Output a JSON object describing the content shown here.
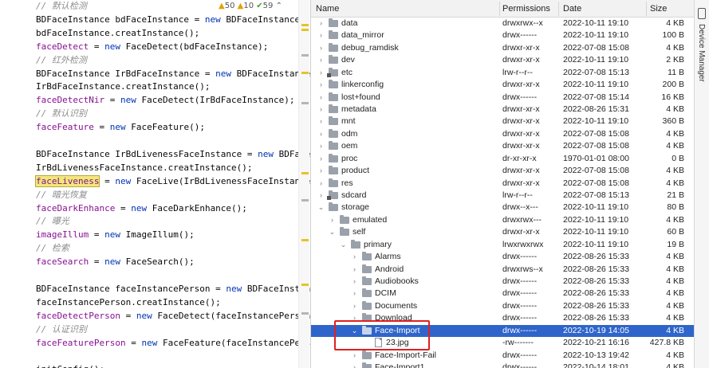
{
  "editor": {
    "inspections": {
      "warnings": "50",
      "weak_warnings": "10",
      "checks": "59"
    },
    "lines": [
      {
        "type": "comment",
        "text": "// 默认检测"
      },
      {
        "type": "code",
        "parts": [
          {
            "t": "BDFaceInstance bdFaceInstance = "
          },
          {
            "t": "new",
            "c": "kw"
          },
          {
            "t": " BDFaceInstance();"
          }
        ]
      },
      {
        "type": "code",
        "parts": [
          {
            "t": "bdFaceInstance.creatInstance();"
          }
        ]
      },
      {
        "type": "code",
        "parts": [
          {
            "t": "faceDetect",
            "c": "fld"
          },
          {
            "t": " = "
          },
          {
            "t": "new",
            "c": "kw"
          },
          {
            "t": " FaceDetect(bdFaceInstance);"
          }
        ]
      },
      {
        "type": "comment",
        "text": "// 红外检测"
      },
      {
        "type": "code",
        "parts": [
          {
            "t": "BDFaceInstance IrBdFaceInstance = "
          },
          {
            "t": "new",
            "c": "kw"
          },
          {
            "t": " BDFaceInstance();"
          }
        ]
      },
      {
        "type": "code",
        "parts": [
          {
            "t": "IrBdFaceInstance.creatInstance();"
          }
        ]
      },
      {
        "type": "code",
        "parts": [
          {
            "t": "faceDetectNir",
            "c": "fld"
          },
          {
            "t": " = "
          },
          {
            "t": "new",
            "c": "kw"
          },
          {
            "t": " FaceDetect(IrBdFaceInstance);"
          }
        ]
      },
      {
        "type": "comment",
        "text": "// 默认识别"
      },
      {
        "type": "code",
        "parts": [
          {
            "t": "faceFeature",
            "c": "fld"
          },
          {
            "t": " = "
          },
          {
            "t": "new",
            "c": "kw"
          },
          {
            "t": " FaceFeature();"
          }
        ]
      },
      {
        "type": "blank"
      },
      {
        "type": "code",
        "parts": [
          {
            "t": "BDFaceInstance IrBdLivenessFaceInstance = "
          },
          {
            "t": "new",
            "c": "kw"
          },
          {
            "t": " BDFaceInstance();"
          }
        ]
      },
      {
        "type": "code",
        "parts": [
          {
            "t": "IrBdLivenessFaceInstance.creatInstance();"
          }
        ]
      },
      {
        "type": "code",
        "parts": [
          {
            "t": "faceLiveness",
            "c": "fld hl"
          },
          {
            "t": " = "
          },
          {
            "t": "new",
            "c": "kw"
          },
          {
            "t": " FaceLive(IrBdLivenessFaceInstance);"
          }
        ]
      },
      {
        "type": "comment",
        "text": "// 暗光恢复"
      },
      {
        "type": "code",
        "parts": [
          {
            "t": "faceDarkEnhance",
            "c": "fld"
          },
          {
            "t": " = "
          },
          {
            "t": "new",
            "c": "kw"
          },
          {
            "t": " FaceDarkEnhance();"
          }
        ]
      },
      {
        "type": "comment",
        "text": "// 曝光"
      },
      {
        "type": "code",
        "parts": [
          {
            "t": "imageIllum",
            "c": "fld"
          },
          {
            "t": " = "
          },
          {
            "t": "new",
            "c": "kw"
          },
          {
            "t": " ImageIllum();"
          }
        ]
      },
      {
        "type": "comment",
        "text": "// 检索"
      },
      {
        "type": "code",
        "parts": [
          {
            "t": "faceSearch",
            "c": "fld"
          },
          {
            "t": " = "
          },
          {
            "t": "new",
            "c": "kw"
          },
          {
            "t": " FaceSearch();"
          }
        ]
      },
      {
        "type": "blank"
      },
      {
        "type": "code",
        "parts": [
          {
            "t": "BDFaceInstance faceInstancePerson = "
          },
          {
            "t": "new",
            "c": "kw"
          },
          {
            "t": " BDFaceInstance();"
          }
        ]
      },
      {
        "type": "code",
        "parts": [
          {
            "t": "faceInstancePerson.creatInstance();"
          }
        ]
      },
      {
        "type": "code",
        "parts": [
          {
            "t": "faceDetectPerson",
            "c": "fld"
          },
          {
            "t": " = "
          },
          {
            "t": "new",
            "c": "kw"
          },
          {
            "t": " FaceDetect(faceInstancePerson);"
          }
        ]
      },
      {
        "type": "comment",
        "text": "// 认证识别"
      },
      {
        "type": "code",
        "parts": [
          {
            "t": "faceFeaturePerson",
            "c": "fld"
          },
          {
            "t": " = "
          },
          {
            "t": "new",
            "c": "kw"
          },
          {
            "t": " FaceFeature(faceInstancePerson);"
          }
        ]
      },
      {
        "type": "blank"
      },
      {
        "type": "code",
        "parts": [
          {
            "t": "initConfig();"
          }
        ]
      }
    ]
  },
  "explorer": {
    "columns": {
      "name": "Name",
      "permissions": "Permissions",
      "date": "Date",
      "size": "Size"
    },
    "rows": [
      {
        "name": "data",
        "perm": "drwxrwx--x",
        "date": "2022-10-11 19:10",
        "size": "4 KB",
        "level": 0,
        "kind": "folder",
        "state": "collapsed"
      },
      {
        "name": "data_mirror",
        "perm": "drwx------",
        "date": "2022-10-11 19:10",
        "size": "100 B",
        "level": 0,
        "kind": "folder",
        "state": "collapsed"
      },
      {
        "name": "debug_ramdisk",
        "perm": "drwxr-xr-x",
        "date": "2022-07-08 15:08",
        "size": "4 KB",
        "level": 0,
        "kind": "folder",
        "state": "collapsed"
      },
      {
        "name": "dev",
        "perm": "drwxr-xr-x",
        "date": "2022-10-11 19:10",
        "size": "2 KB",
        "level": 0,
        "kind": "folder",
        "state": "collapsed"
      },
      {
        "name": "etc",
        "perm": "lrw-r--r--",
        "date": "2022-07-08 15:13",
        "size": "11 B",
        "level": 0,
        "kind": "link",
        "state": "collapsed"
      },
      {
        "name": "linkerconfig",
        "perm": "drwxr-xr-x",
        "date": "2022-10-11 19:10",
        "size": "200 B",
        "level": 0,
        "kind": "folder",
        "state": "collapsed"
      },
      {
        "name": "lost+found",
        "perm": "drwx------",
        "date": "2022-07-08 15:14",
        "size": "16 KB",
        "level": 0,
        "kind": "folder",
        "state": "collapsed"
      },
      {
        "name": "metadata",
        "perm": "drwxr-xr-x",
        "date": "2022-08-26 15:31",
        "size": "4 KB",
        "level": 0,
        "kind": "folder",
        "state": "collapsed"
      },
      {
        "name": "mnt",
        "perm": "drwxr-xr-x",
        "date": "2022-10-11 19:10",
        "size": "360 B",
        "level": 0,
        "kind": "folder",
        "state": "collapsed"
      },
      {
        "name": "odm",
        "perm": "drwxr-xr-x",
        "date": "2022-07-08 15:08",
        "size": "4 KB",
        "level": 0,
        "kind": "folder",
        "state": "collapsed"
      },
      {
        "name": "oem",
        "perm": "drwxr-xr-x",
        "date": "2022-07-08 15:08",
        "size": "4 KB",
        "level": 0,
        "kind": "folder",
        "state": "collapsed"
      },
      {
        "name": "proc",
        "perm": "dr-xr-xr-x",
        "date": "1970-01-01 08:00",
        "size": "0 B",
        "level": 0,
        "kind": "folder",
        "state": "collapsed"
      },
      {
        "name": "product",
        "perm": "drwxr-xr-x",
        "date": "2022-07-08 15:08",
        "size": "4 KB",
        "level": 0,
        "kind": "folder",
        "state": "collapsed"
      },
      {
        "name": "res",
        "perm": "drwxr-xr-x",
        "date": "2022-07-08 15:08",
        "size": "4 KB",
        "level": 0,
        "kind": "folder",
        "state": "collapsed"
      },
      {
        "name": "sdcard",
        "perm": "lrw-r--r--",
        "date": "2022-07-08 15:13",
        "size": "21 B",
        "level": 0,
        "kind": "link",
        "state": "collapsed"
      },
      {
        "name": "storage",
        "perm": "drwx--x---",
        "date": "2022-10-11 19:10",
        "size": "80 B",
        "level": 0,
        "kind": "folder",
        "state": "expanded"
      },
      {
        "name": "emulated",
        "perm": "drwxrwx---",
        "date": "2022-10-11 19:10",
        "size": "4 KB",
        "level": 1,
        "kind": "folder",
        "state": "collapsed"
      },
      {
        "name": "self",
        "perm": "drwxr-xr-x",
        "date": "2022-10-11 19:10",
        "size": "60 B",
        "level": 1,
        "kind": "folder",
        "state": "expanded"
      },
      {
        "name": "primary",
        "perm": "lrwxrwxrwx",
        "date": "2022-10-11 19:10",
        "size": "19 B",
        "level": 2,
        "kind": "folder",
        "state": "expanded"
      },
      {
        "name": "Alarms",
        "perm": "drwx------",
        "date": "2022-08-26 15:33",
        "size": "4 KB",
        "level": 3,
        "kind": "folder",
        "state": "collapsed"
      },
      {
        "name": "Android",
        "perm": "drwxrws--x",
        "date": "2022-08-26 15:33",
        "size": "4 KB",
        "level": 3,
        "kind": "folder",
        "state": "collapsed"
      },
      {
        "name": "Audiobooks",
        "perm": "drwx------",
        "date": "2022-08-26 15:33",
        "size": "4 KB",
        "level": 3,
        "kind": "folder",
        "state": "collapsed"
      },
      {
        "name": "DCIM",
        "perm": "drwx------",
        "date": "2022-08-26 15:33",
        "size": "4 KB",
        "level": 3,
        "kind": "folder",
        "state": "collapsed"
      },
      {
        "name": "Documents",
        "perm": "drwx------",
        "date": "2022-08-26 15:33",
        "size": "4 KB",
        "level": 3,
        "kind": "folder",
        "state": "collapsed"
      },
      {
        "name": "Download",
        "perm": "drwx------",
        "date": "2022-08-26 15:33",
        "size": "4 KB",
        "level": 3,
        "kind": "folder",
        "state": "collapsed"
      },
      {
        "name": "Face-Import",
        "perm": "drwx------",
        "date": "2022-10-19 14:05",
        "size": "4 KB",
        "level": 3,
        "kind": "folder",
        "state": "expanded",
        "selected": true
      },
      {
        "name": "23.jpg",
        "perm": "-rw-------",
        "date": "2022-10-21 16:16",
        "size": "427.8 KB",
        "level": 4,
        "kind": "file",
        "state": "none"
      },
      {
        "name": "Face-Import-Fail",
        "perm": "drwx------",
        "date": "2022-10-13 19:42",
        "size": "4 KB",
        "level": 3,
        "kind": "folder",
        "state": "collapsed"
      },
      {
        "name": "Face-Import1",
        "perm": "drwx------",
        "date": "2022-10-14 18:01",
        "size": "4 KB",
        "level": 3,
        "kind": "folder",
        "state": "collapsed"
      }
    ]
  },
  "side_panel": {
    "label": "Device Manager"
  },
  "colors": {
    "selection": "#2f65ca",
    "highlight_box": "#e02020",
    "keyword": "#0033b3",
    "field": "#871094",
    "comment": "#8c8c8c"
  }
}
